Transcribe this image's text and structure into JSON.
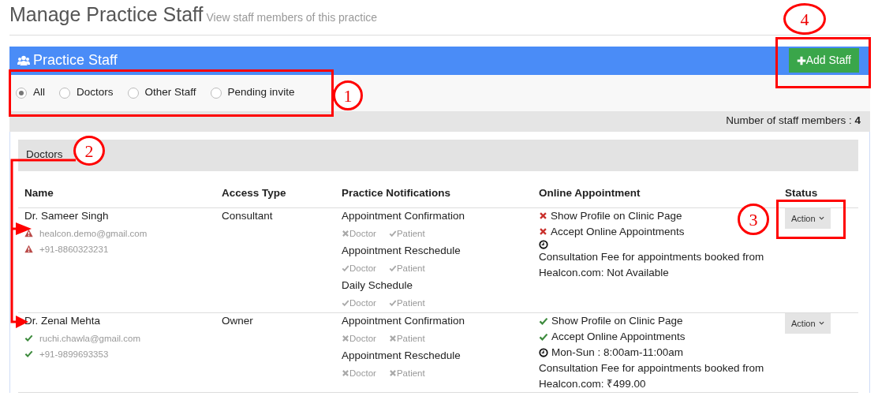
{
  "page": {
    "title": "Manage Practice Staff",
    "subtitle": "View staff members of this practice"
  },
  "panel": {
    "title": "Practice Staff",
    "add_button": "Add Staff"
  },
  "filters": [
    {
      "label": "All",
      "selected": true
    },
    {
      "label": "Doctors",
      "selected": false
    },
    {
      "label": "Other Staff",
      "selected": false
    },
    {
      "label": "Pending invite",
      "selected": false
    }
  ],
  "count": {
    "label": "Number of staff members :",
    "value": "4"
  },
  "section": {
    "title": "Doctors"
  },
  "table": {
    "columns": [
      "Name",
      "Access Type",
      "Practice Notifications",
      "Online Appointment",
      "Status"
    ],
    "rows": [
      {
        "name": "Dr. Sameer Singh",
        "email": {
          "text": "healcon.demo@gmail.com",
          "verified": false
        },
        "phone": {
          "text": "+91-8860323231",
          "verified": false
        },
        "access": "Consultant",
        "notifications": [
          {
            "label": "Appointment Confirmation",
            "doctor": {
              "text": "Doctor",
              "on": false
            },
            "patient": {
              "text": "Patient",
              "on": true
            }
          },
          {
            "label": "Appointment Reschedule",
            "doctor": {
              "text": "Doctor",
              "on": true
            },
            "patient": {
              "text": "Patient",
              "on": true
            }
          },
          {
            "label": "Daily Schedule",
            "doctor": {
              "text": "Doctor",
              "on": true
            },
            "patient": {
              "text": "Patient",
              "on": true
            }
          }
        ],
        "online": {
          "show_profile": {
            "text": "Show Profile on Clinic Page",
            "on": false
          },
          "accept": {
            "text": "Accept Online Appointments",
            "on": false
          },
          "fee": "Consultation Fee for appointments booked from Healcon.com: Not Available"
        },
        "action": "Action"
      },
      {
        "name": "Dr. Zenal Mehta",
        "email": {
          "text": "ruchi.chawla@gmail.com",
          "verified": true
        },
        "phone": {
          "text": "+91-9899693353",
          "verified": true
        },
        "access": "Owner",
        "notifications": [
          {
            "label": "Appointment Confirmation",
            "doctor": {
              "text": "Doctor",
              "on": false
            },
            "patient": {
              "text": "Patient",
              "on": false
            }
          },
          {
            "label": "Appointment Reschedule",
            "doctor": {
              "text": "Doctor",
              "on": false
            },
            "patient": {
              "text": "Patient",
              "on": false
            }
          }
        ],
        "online": {
          "show_profile": {
            "text": "Show Profile on Clinic Page",
            "on": true
          },
          "accept": {
            "text": "Accept Online Appointments",
            "on": true
          },
          "schedule": "Mon-Sun : 8:00am-11:00am",
          "fee": "Consultation Fee for appointments booked from Healcon.com: ₹499.00"
        },
        "action": "Action"
      }
    ]
  },
  "annotations": [
    {
      "label": "1"
    },
    {
      "label": "2"
    },
    {
      "label": "3"
    },
    {
      "label": "4"
    }
  ]
}
